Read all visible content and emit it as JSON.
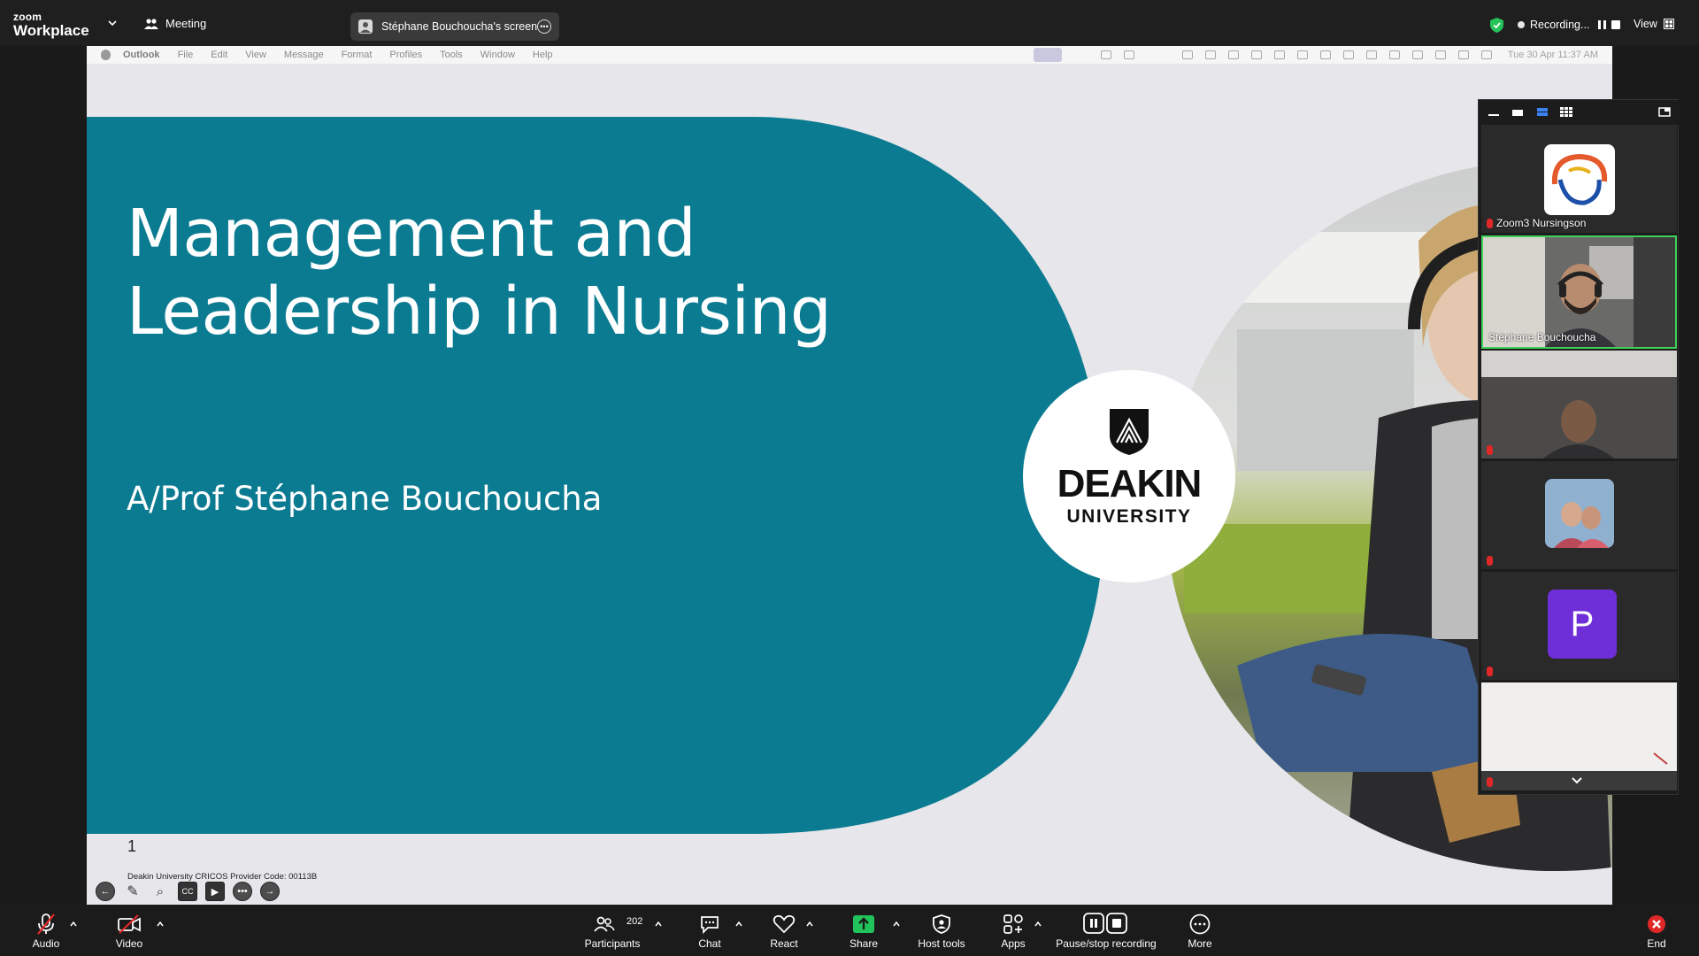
{
  "topbar": {
    "brand_small": "zoom",
    "brand_big": "Workplace",
    "meeting_label": "Meeting",
    "shared_screen_label": "Stéphane Bouchoucha's screen",
    "recording_label": "Recording...",
    "view_label": "View"
  },
  "mac_menubar": {
    "app": "Outlook",
    "items": [
      "File",
      "Edit",
      "View",
      "Message",
      "Format",
      "Profiles",
      "Tools",
      "Window",
      "Help"
    ],
    "clock": "Tue 30 Apr  11:37 AM"
  },
  "slide": {
    "title": "Management and\nLeadership in Nursing",
    "subtitle": "A/Prof Stéphane Bouchoucha",
    "number": "1",
    "cricos": "Deakin University CRICOS Provider Code: 00113B",
    "logo_line1": "DEAKIN",
    "logo_line2": "UNIVERSITY",
    "teal_color": "#0b7b91"
  },
  "gallery": {
    "participants": [
      {
        "name": "Zoom3 Nursingson",
        "muted": true
      },
      {
        "name": "Stéphane Bouchoucha",
        "muted": false,
        "active": true
      },
      {
        "name": "",
        "muted": true
      },
      {
        "name": "",
        "muted": true
      },
      {
        "name": "",
        "muted": true,
        "avatar_letter": "P"
      },
      {
        "name": "",
        "muted": true
      }
    ]
  },
  "toolbar": {
    "audio": "Audio",
    "video": "Video",
    "participants": "Participants",
    "participants_count": "202",
    "chat": "Chat",
    "react": "React",
    "share": "Share",
    "host_tools": "Host tools",
    "apps": "Apps",
    "pause_stop_recording": "Pause/stop recording",
    "more": "More",
    "end": "End",
    "share_color": "#21c35b",
    "end_color": "#e02828"
  }
}
